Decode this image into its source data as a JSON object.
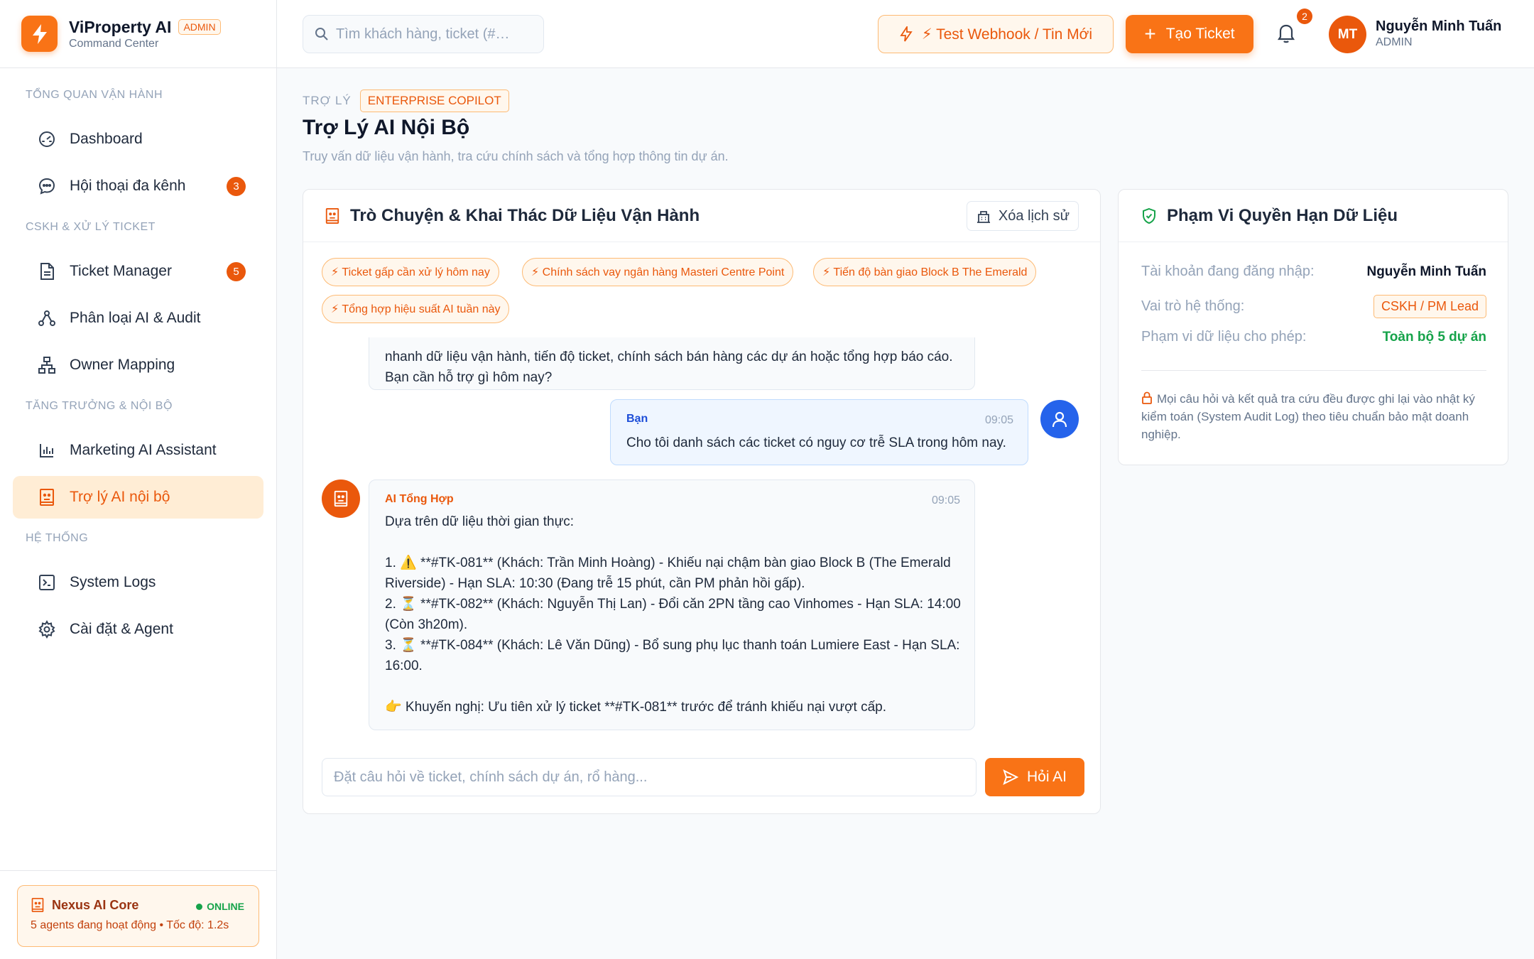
{
  "brand": {
    "name": "ViProperty AI",
    "badge": "ADMIN",
    "subtitle": "Command Center"
  },
  "sidebar": {
    "sections": [
      {
        "title": "TỔNG QUAN VẬN HÀNH",
        "items": [
          {
            "label": "Dashboard",
            "icon": "gauge-icon"
          },
          {
            "label": "Hội thoại đa kênh",
            "icon": "chat-bubble-icon",
            "count": "3"
          }
        ]
      },
      {
        "title": "CSKH & XỬ LÝ TICKET",
        "items": [
          {
            "label": "Ticket Manager",
            "icon": "document-icon",
            "count": "5"
          },
          {
            "label": "Phân loại AI & Audit",
            "icon": "nodes-icon"
          },
          {
            "label": "Owner Mapping",
            "icon": "org-chart-icon"
          }
        ]
      },
      {
        "title": "TĂNG TRƯỞNG & NỘI BỘ",
        "items": [
          {
            "label": "Marketing AI Assistant",
            "icon": "bar-chart-icon"
          },
          {
            "label": "Trợ lý AI nội bộ",
            "icon": "bot-icon",
            "active": true
          }
        ]
      },
      {
        "title": "HỆ THỐNG",
        "items": [
          {
            "label": "System Logs",
            "icon": "terminal-icon"
          },
          {
            "label": "Cài đặt & Agent",
            "icon": "gear-icon"
          }
        ]
      }
    ],
    "core": {
      "name": "Nexus AI Core",
      "status": "ONLINE",
      "description": "5 agents đang hoạt động • Tốc độ: 1.2s"
    }
  },
  "header": {
    "search_placeholder": "Tìm khách hàng, ticket (#…",
    "webhook_label": "⚡ Test Webhook / Tin Mới",
    "create_label": "Tạo Ticket",
    "notification_count": "2",
    "user": {
      "initials": "MT",
      "name": "Nguyễn Minh Tuấn",
      "role": "ADMIN"
    }
  },
  "page": {
    "crumb_label": "TRỢ LÝ",
    "crumb_badge": "ENTERPRISE COPILOT",
    "title": "Trợ Lý AI Nội Bộ",
    "description": "Truy vấn dữ liệu vận hành, tra cứu chính sách và tổng hợp thông tin dự án."
  },
  "chat": {
    "title": "Trò Chuyện & Khai Thác Dữ Liệu Vận Hành",
    "clear_label": "Xóa lịch sử",
    "chips": [
      "⚡ Ticket gấp cần xử lý hôm nay",
      "⚡ Chính sách vay ngân hàng Masteri Centre Point",
      "⚡ Tiến độ bàn giao Block B The Emerald",
      "⚡ Tổng hợp hiệu suất AI tuần này"
    ],
    "messages": [
      {
        "text": "nhanh dữ liệu vận hành, tiến độ ticket, chính sách bán hàng các dự án hoặc tổng hợp báo cáo. Bạn cần hỗ trợ gì hôm nay?"
      },
      {
        "sender": "Bạn",
        "time": "09:05",
        "text": "Cho tôi danh sách các ticket có nguy cơ trễ SLA trong hôm nay."
      },
      {
        "sender": "AI Tổng Hợp",
        "time": "09:05",
        "text": "Dựa trên dữ liệu thời gian thực:\n\n1. ⚠️ **#TK-081** (Khách: Trần Minh Hoàng) - Khiếu nại chậm bàn giao Block B (The Emerald Riverside) - Hạn SLA: 10:30 (Đang trễ 15 phút, cần PM phản hồi gấp).\n2. ⏳ **#TK-082** (Khách: Nguyễn Thị Lan) - Đổi căn 2PN tầng cao Vinhomes - Hạn SLA: 14:00 (Còn 3h20m).\n3. ⏳ **#TK-084** (Khách: Lê Văn Dũng) - Bổ sung phụ lục thanh toán Lumiere East - Hạn SLA: 16:00.\n\n👉 Khuyến nghị: Ưu tiên xử lý ticket **#TK-081** trước để tránh khiếu nại vượt cấp."
      }
    ],
    "input_placeholder": "Đặt câu hỏi về ticket, chính sách dự án, rổ hàng...",
    "ask_label": "Hỏi AI"
  },
  "scope": {
    "title": "Phạm Vi Quyền Hạn Dữ Liệu",
    "rows": [
      {
        "label": "Tài khoản đang đăng nhập:",
        "value": "Nguyễn Minh Tuấn"
      },
      {
        "label": "Vai trò hệ thống:",
        "value": "CSKH / PM Lead"
      },
      {
        "label": "Phạm vi dữ liệu cho phép:",
        "value": "Toàn bộ 5 dự án"
      }
    ],
    "note": "Mọi câu hỏi và kết quả tra cứu đều được ghi lại vào nhật ký kiểm toán (System Audit Log) theo tiêu chuẩn bảo mật doanh nghiệp."
  },
  "colors": {
    "accent": "#f97316",
    "accent_dark": "#ea580c",
    "success": "#16a34a",
    "user_blue": "#2563eb"
  }
}
